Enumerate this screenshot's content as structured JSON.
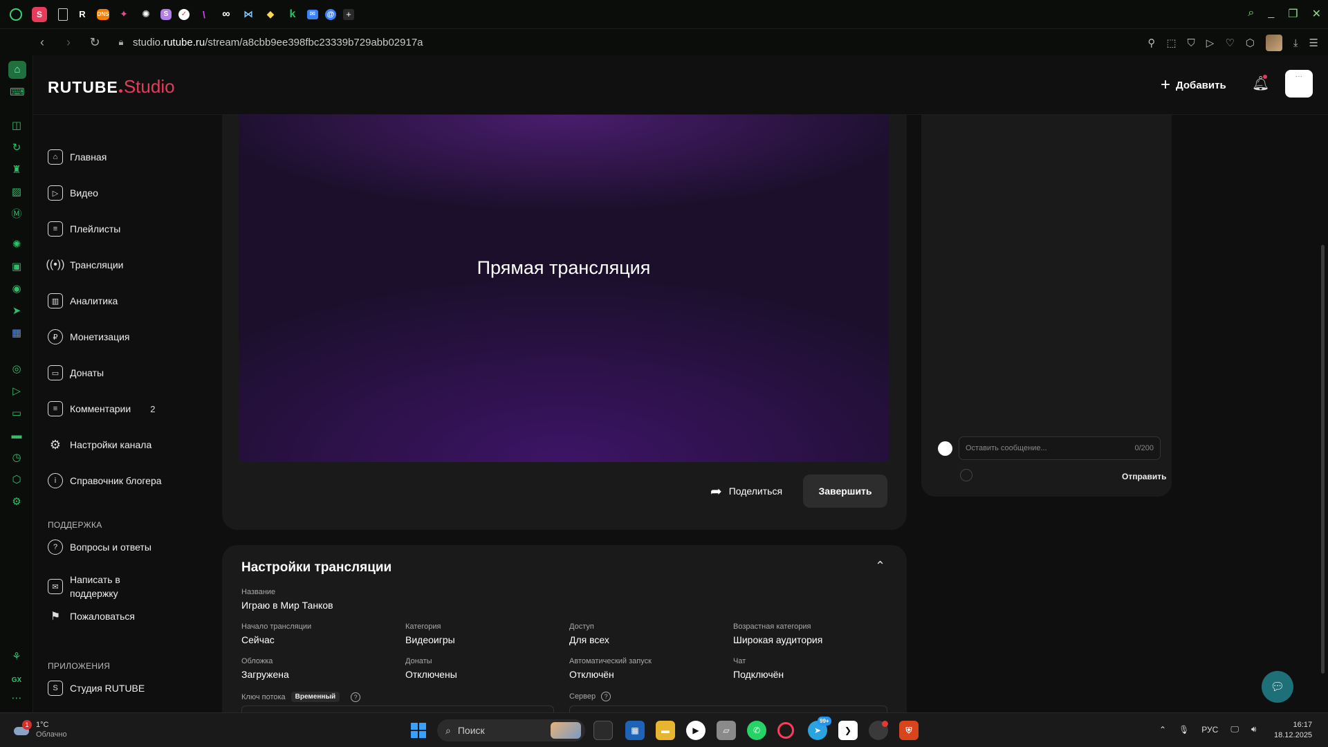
{
  "browser": {
    "url_host": "studio.rutube.ru",
    "url_path": "/stream/a8cbb9ee398fbc23339b729abb02917a"
  },
  "header": {
    "logo_main": "RUTUBE",
    "logo_sub": "Studio",
    "add_label": "Добавить"
  },
  "nav": {
    "items": [
      {
        "label": "Главная",
        "icon": "home-icon"
      },
      {
        "label": "Видео",
        "icon": "video-icon"
      },
      {
        "label": "Плейлисты",
        "icon": "playlist-icon"
      },
      {
        "label": "Трансляции",
        "icon": "broadcast-icon"
      },
      {
        "label": "Аналитика",
        "icon": "analytics-icon"
      },
      {
        "label": "Монетизация",
        "icon": "ruble-icon"
      },
      {
        "label": "Донаты",
        "icon": "wallet-icon"
      },
      {
        "label": "Комментарии",
        "icon": "comment-icon",
        "badge": "2"
      },
      {
        "label": "Настройки канала",
        "icon": "gear-icon"
      },
      {
        "label": "Справочник блогера",
        "icon": "info-icon"
      }
    ],
    "support_title": "ПОДДЕРЖКА",
    "support_items": [
      {
        "label": "Вопросы и ответы",
        "icon": "question-icon"
      },
      {
        "label": "Написать в поддержку",
        "icon": "mail-icon"
      },
      {
        "label": "Пожаловаться",
        "icon": "flag-icon"
      }
    ],
    "apps_title": "ПРИЛОЖЕНИЯ",
    "apps_items": [
      {
        "label": "Студия RUTUBE",
        "icon": "studio-app-icon"
      }
    ]
  },
  "player": {
    "title": "Прямая трансляция",
    "share_label": "Поделиться",
    "finish_label": "Завершить"
  },
  "chat": {
    "placeholder": "Оставить сообщение...",
    "counter": "0/200",
    "send_label": "Отправить"
  },
  "settings": {
    "title": "Настройки трансляции",
    "name_label": "Название",
    "name_value": "Играю в Мир Танков",
    "fields": [
      {
        "label": "Начало трансляции",
        "value": "Сейчас"
      },
      {
        "label": "Категория",
        "value": "Видеоигры"
      },
      {
        "label": "Доступ",
        "value": "Для всех"
      },
      {
        "label": "Возрастная категория",
        "value": "Широкая аудитория"
      },
      {
        "label": "Обложка",
        "value": "Загружена"
      },
      {
        "label": "Донаты",
        "value": "Отключены"
      },
      {
        "label": "Автоматический запуск",
        "value": "Отключён"
      },
      {
        "label": "Чат",
        "value": "Подключён"
      }
    ],
    "stream_key_label": "Ключ потока",
    "stream_key_badge": "Временный",
    "server_label": "Сервер"
  },
  "taskbar": {
    "temperature": "1°C",
    "weather": "Облачно",
    "weather_badge": "1",
    "search_label": "Поиск",
    "telegram_badge": "99+",
    "language": "РУС",
    "time": "16:17",
    "date": "18.12.2025"
  }
}
